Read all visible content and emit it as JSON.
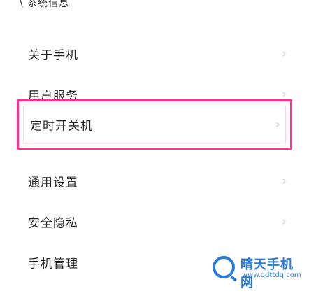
{
  "header": {
    "partial_text": "\\ 系统信息"
  },
  "menu": {
    "items": [
      {
        "label": "关于手机"
      },
      {
        "label": "用户服务"
      },
      {
        "label": "定时开关机"
      },
      {
        "label": "通用设置"
      },
      {
        "label": "安全隐私"
      },
      {
        "label": "手机管理"
      }
    ],
    "chevron": "›"
  },
  "watermark": {
    "title": "晴天手机网",
    "url": "www.qdttdq.com"
  },
  "colors": {
    "highlight": "#ff2f8f",
    "chevron": "#cfcfcf",
    "watermark": "#2a7bd6"
  }
}
